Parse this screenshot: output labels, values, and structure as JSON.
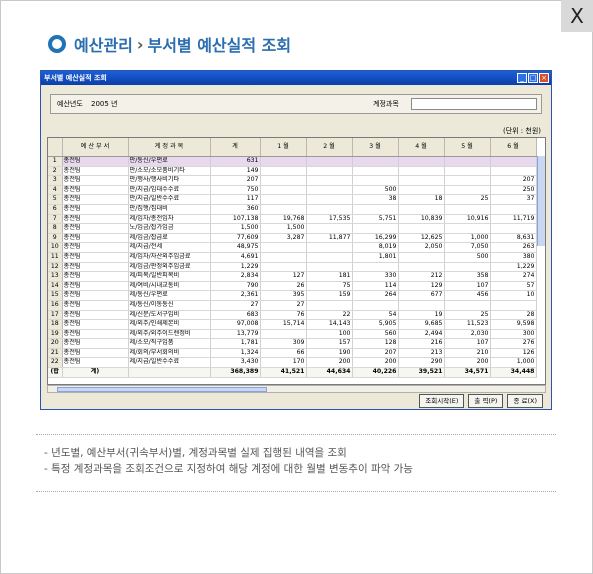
{
  "page": {
    "close_label": "X",
    "title_part1": "예산관리",
    "title_chevron": "›",
    "title_part2": "부서별 예산실적 조회"
  },
  "window": {
    "title": "부서별 예산실적 조회",
    "controls": [
      "_",
      "□",
      "×"
    ],
    "filter_year_label": "예산년도",
    "filter_year_value": "2005 년",
    "filter_account_label": "계정과목",
    "filter_account_value": "",
    "unit_label": "(단위 : 천원)"
  },
  "table": {
    "columns": [
      "",
      "예 산 부 서",
      "계 정 과 목",
      "계",
      "1 월",
      "2 월",
      "3 월",
      "4 월",
      "5 월",
      "6 월"
    ],
    "rows": [
      [
        "1",
        "총전팀",
        "판/통신/우편료",
        "631",
        "",
        "",
        "",
        "",
        "",
        ""
      ],
      [
        "2",
        "총전팀",
        "판/소모/소모품비기타",
        "149",
        "",
        "",
        "",
        "",
        "",
        ""
      ],
      [
        "3",
        "총전팀",
        "판/행사/행사비기타",
        "207",
        "",
        "",
        "",
        "",
        "",
        "207"
      ],
      [
        "4",
        "총전팀",
        "판/지급/임대수수료",
        "750",
        "",
        "",
        "500",
        "",
        "",
        "250"
      ],
      [
        "5",
        "총전팀",
        "판/지급/일반수수료",
        "117",
        "",
        "",
        "38",
        "18",
        "25",
        "37"
      ],
      [
        "6",
        "총전팀",
        "판/집행/집대비",
        "360",
        "",
        "",
        "",
        "",
        "",
        ""
      ],
      [
        "7",
        "총전팀",
        "제/임차/총전임차",
        "107,138",
        "19,768",
        "17,535",
        "5,751",
        "10,839",
        "10,916",
        "11,719"
      ],
      [
        "8",
        "총전팀",
        "노/임금/잡가임금",
        "1,500",
        "1,500",
        "",
        "",
        "",
        "",
        ""
      ],
      [
        "9",
        "총전팀",
        "제/임금/잡급료",
        "77,609",
        "3,287",
        "11,877",
        "16,299",
        "12,625",
        "1,000",
        "8,631"
      ],
      [
        "10",
        "총전팀",
        "제/지급/전세",
        "48,975",
        "",
        "",
        "8,019",
        "2,050",
        "7,050",
        "263"
      ],
      [
        "11",
        "총전팀",
        "제/임차/자산외주임금료",
        "4,691",
        "",
        "",
        "1,801",
        "",
        "500",
        "380"
      ],
      [
        "12",
        "총전팀",
        "제/임금/판정외주임금료",
        "1,229",
        "",
        "",
        "",
        "",
        "",
        "1,229"
      ],
      [
        "13",
        "총전팀",
        "제/피복/일반피복비",
        "2,834",
        "127",
        "181",
        "330",
        "212",
        "358",
        "274"
      ],
      [
        "14",
        "총전팀",
        "제/여비/시내교통비",
        "790",
        "26",
        "75",
        "114",
        "129",
        "107",
        "57"
      ],
      [
        "15",
        "총전팀",
        "제/통신/우편료",
        "2,361",
        "395",
        "159",
        "264",
        "677",
        "456",
        "10"
      ],
      [
        "16",
        "총전팀",
        "제/통신/이동통신",
        "27",
        "27",
        "",
        "",
        "",
        "",
        ""
      ],
      [
        "17",
        "총전팀",
        "제/신문/도서구입비",
        "683",
        "76",
        "22",
        "54",
        "19",
        "25",
        "28"
      ],
      [
        "18",
        "총전팀",
        "제/외주/인쇄제본비",
        "97,008",
        "15,714",
        "14,143",
        "5,905",
        "9,685",
        "11,523",
        "9,598"
      ],
      [
        "19",
        "총전팀",
        "제/외주/외주이드렌정비",
        "13,779",
        "",
        "100",
        "560",
        "2,494",
        "2,030",
        "300"
      ],
      [
        "20",
        "총전팀",
        "제/소모/직구입품",
        "1,781",
        "309",
        "157",
        "128",
        "216",
        "107",
        "276"
      ],
      [
        "21",
        "총전팀",
        "제/회의/부서회의비",
        "1,324",
        "66",
        "190",
        "207",
        "213",
        "210",
        "126"
      ],
      [
        "22",
        "총전팀",
        "제/지급/일반수수료",
        "3,430",
        "170",
        "200",
        "200",
        "290",
        "200",
        "1,000"
      ]
    ],
    "total": [
      "(합",
      "계)",
      "",
      "368,389",
      "41,521",
      "44,634",
      "40,226",
      "39,521",
      "34,571",
      "34,448"
    ]
  },
  "buttons": {
    "search": "조회시작(E)",
    "print": "출 력(P)",
    "close": "종 료(X)"
  },
  "notes": [
    "- 년도별, 예산부서(귀속부서)별, 계정과목별 실제 집행된 내역을 조회",
    "- 특정 계정과목을 조회조건으로 지정하여 해당 계정에 대한 월별 변동추이 파악 가능"
  ],
  "colors": {
    "accent": "#2a6db0",
    "titlebar": "#0c3ea8",
    "highlight_row": "#e9d9ee"
  }
}
